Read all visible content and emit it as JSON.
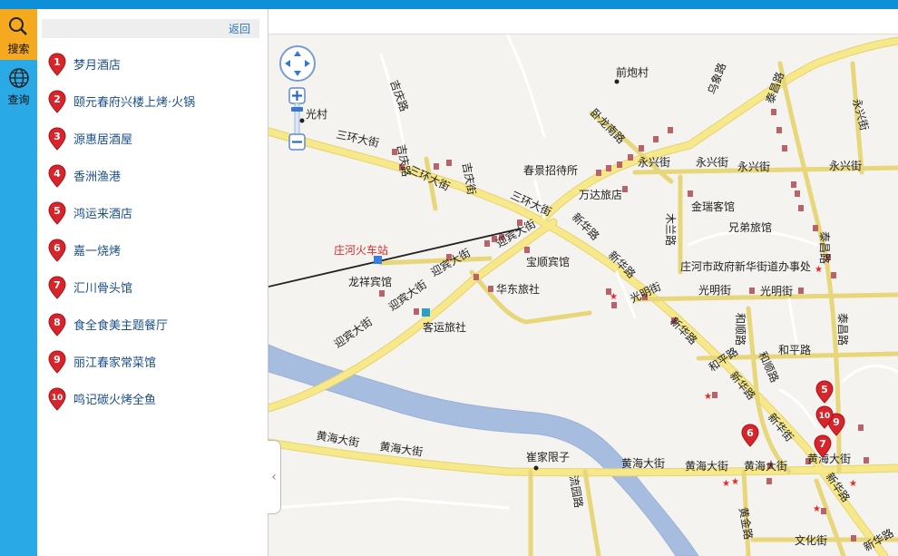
{
  "nav": {
    "search_label": "搜索",
    "query_label": "查询",
    "search_icon": "search-icon",
    "query_icon": "globe-icon"
  },
  "panel": {
    "back_label": "返回",
    "results": [
      {
        "num": "1",
        "name": "梦月酒店"
      },
      {
        "num": "2",
        "name": "颐元春府兴楼上烤·火锅"
      },
      {
        "num": "3",
        "name": "源惠居酒屋"
      },
      {
        "num": "4",
        "name": "香洲渔港"
      },
      {
        "num": "5",
        "name": "鸿运来酒店"
      },
      {
        "num": "6",
        "name": "嘉一烧烤"
      },
      {
        "num": "7",
        "name": "汇川骨头馆"
      },
      {
        "num": "8",
        "name": "食全食美主题餐厅"
      },
      {
        "num": "9",
        "name": "丽江春家常菜馆"
      },
      {
        "num": "10",
        "name": "鸣记碳火烤全鱼"
      }
    ]
  },
  "map": {
    "pin_color": "#d8242b",
    "road_color": "#f7e98b",
    "water_color": "#a7bde0",
    "station": "庄河火车站",
    "labels": {
      "guangcun": "光村",
      "huanglingcun": "前炮村",
      "jiqinglu": "吉庆路",
      "sanhuandajie": "三环大街",
      "sanhuandajie2": "三环大街",
      "shihualu": "吉庆路",
      "changzhengjie": "吉庆街",
      "chunjingzhaodaisuo": "春景招待所",
      "wandalvdian": "万达旅店",
      "yongxingjie1": "永兴街",
      "yongxingjie2": "永兴街",
      "yongxingjie3": "永兴街",
      "yongxingjie4": "永兴街",
      "yongxingjie_v": "永兴街",
      "taichanglu": "泰昌路",
      "wolonglu": "卧龙南路",
      "wuxianglu": "乌象路",
      "jinruikeguan": "金瑞客馆",
      "xiongdilvguan": "兄弟旅馆",
      "mulanlu": "木兰路",
      "zhuanghezhengfu": "庄河市政府新华街道办事处",
      "taichanglu2": "泰昌路",
      "baoshunbinguan": "宝顺宾馆",
      "longxiangbinguan": "龙祥宾馆",
      "huadonglvshe": "华东旅社",
      "keyunlvshe": "客运旅社",
      "yingbindajie1": "迎宾大街",
      "yingbindajie2": "迎宾大街",
      "yingbindajie3": "迎宾大街",
      "yingbindajie4": "迎宾大街",
      "xinhualu1": "新华路",
      "xinhualu2": "新华路",
      "xinhualu3": "新华路",
      "xinhualu4": "新华路",
      "xinhualu5": "新华街",
      "xinhualu6": "新华路",
      "guangmingjie1": "光明街",
      "guangmingjie2": "光明街",
      "guangmingjie3": "光明街",
      "heshunlu1": "和顺路",
      "heshunlu2": "和顺路",
      "hepingjie1": "和平路",
      "hepingjie2": "和平路",
      "taichanglu3": "泰昌路",
      "huanghaidajie1": "黄海大街",
      "huanghaidajie2": "黄海大街",
      "huanghaidajie3": "黄海大街",
      "huanghaidajie4": "黄海大街",
      "huanghaidajie5": "黄海大街",
      "huanghaidajie6": "黄海大街",
      "cuijiaxianzi": "崔家限子",
      "liuyuanlu": "流园路",
      "huangjinlu": "黄金路",
      "wenhuajie": "文化街",
      "xinhualu7": "新华路",
      "huanghai7": "黄海"
    },
    "markers": [
      {
        "num": "5",
        "name": "鸿运来酒店"
      },
      {
        "num": "6",
        "name": "嘉一烧烤"
      },
      {
        "num": "7",
        "name": "汇川骨头馆"
      },
      {
        "num": "9",
        "name": "丽江春家常菜馆"
      },
      {
        "num": "10",
        "name": "鸣记碳火烤全鱼"
      }
    ]
  }
}
